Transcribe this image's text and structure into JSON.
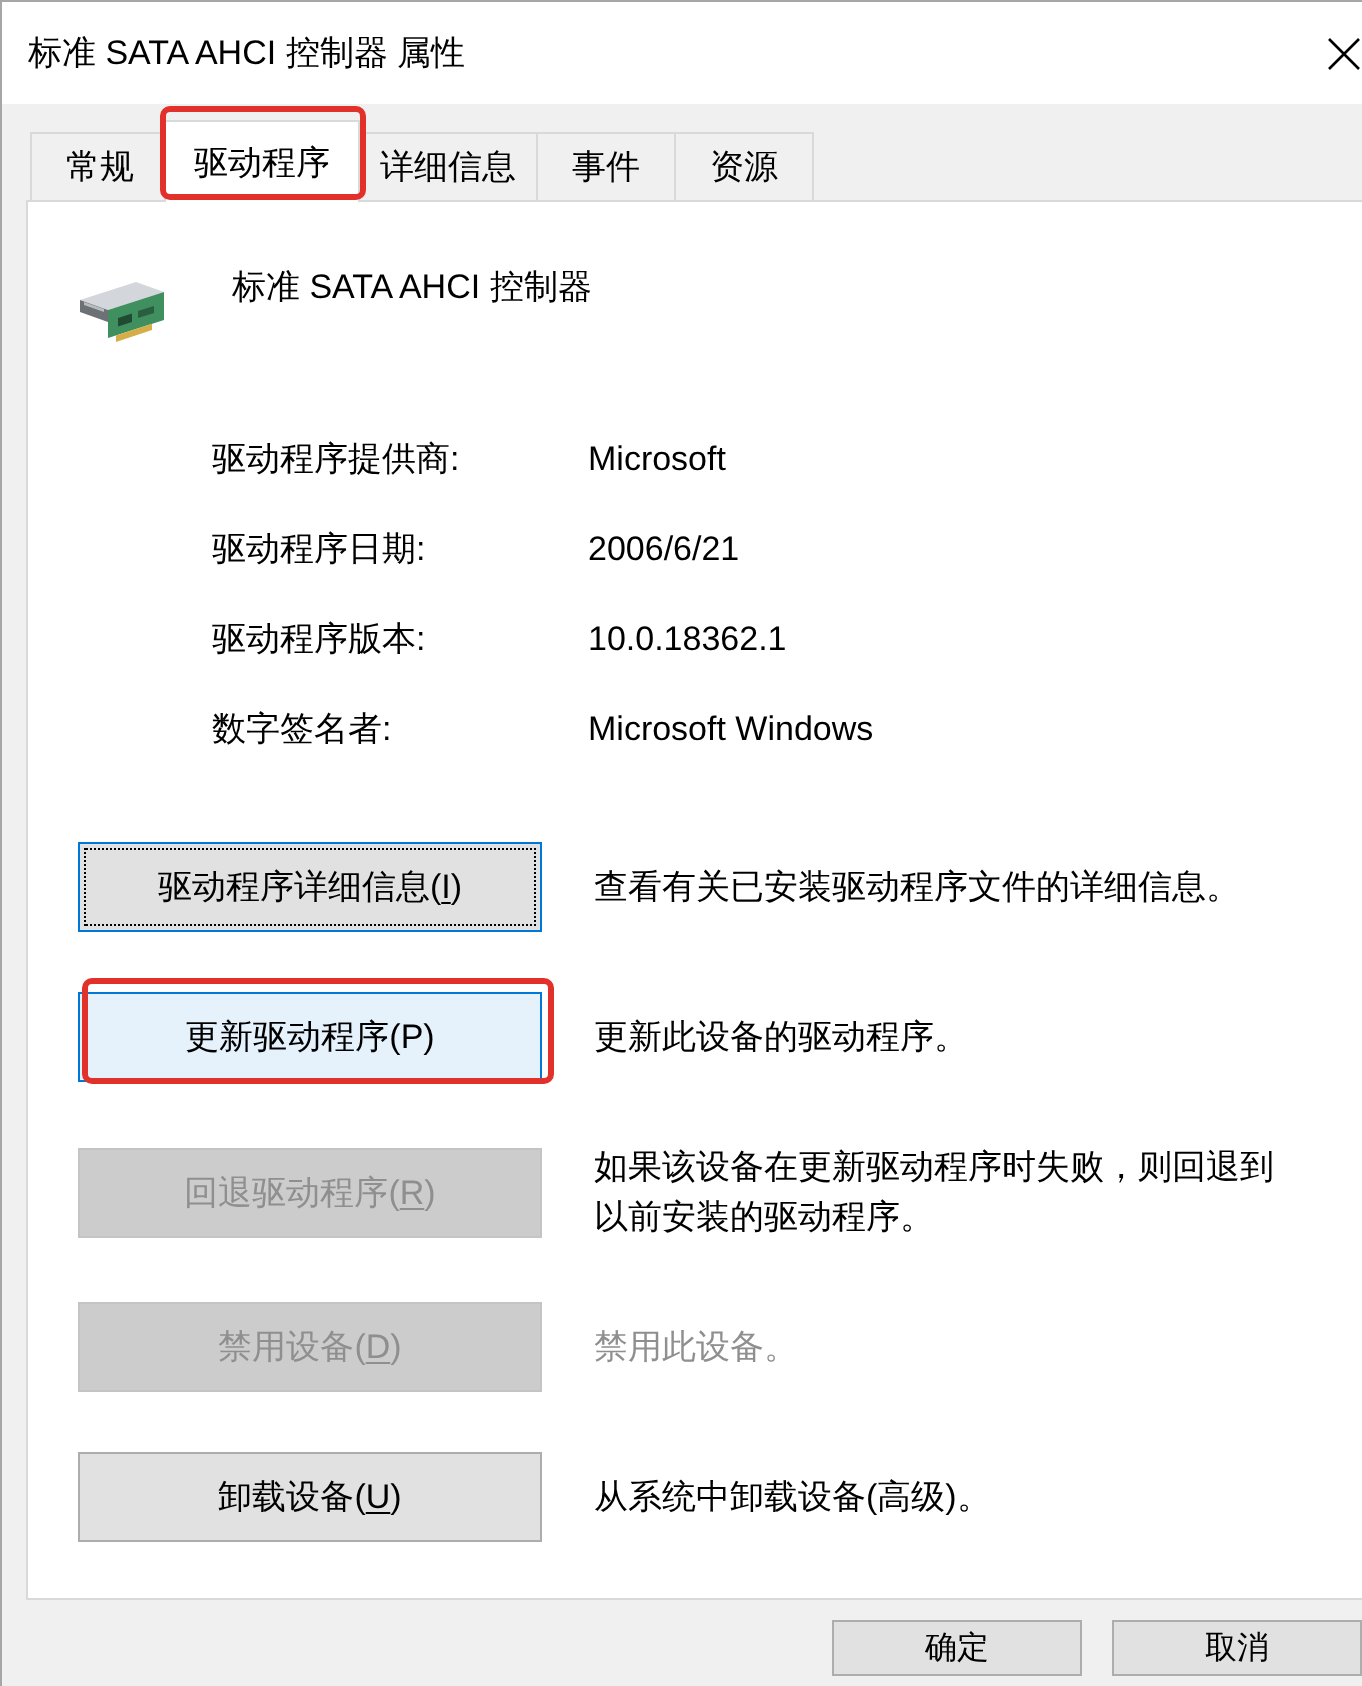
{
  "window": {
    "title": "标准 SATA AHCI 控制器 属性"
  },
  "tabs": [
    {
      "label": "常规",
      "selected": false,
      "highlighted": false
    },
    {
      "label": "驱动程序",
      "selected": true,
      "highlighted": true
    },
    {
      "label": "详细信息",
      "selected": false,
      "highlighted": false
    },
    {
      "label": "事件",
      "selected": false,
      "highlighted": false
    },
    {
      "label": "资源",
      "selected": false,
      "highlighted": false
    }
  ],
  "device": {
    "name": "标准 SATA AHCI 控制器"
  },
  "properties": [
    {
      "label": "驱动程序提供商:",
      "value": "Microsoft"
    },
    {
      "label": "驱动程序日期:",
      "value": "2006/6/21"
    },
    {
      "label": "驱动程序版本:",
      "value": "10.0.18362.1"
    },
    {
      "label": "数字签名者:",
      "value": "Microsoft Windows"
    }
  ],
  "actions": [
    {
      "button": {
        "label": "驱动程序详细信息(I)",
        "access_key_underlined": true,
        "focused": true,
        "hovered": false,
        "disabled": false,
        "highlighted": false
      },
      "description": {
        "text": "查看有关已安装驱动程序文件的详细信息。",
        "disabled": false
      }
    },
    {
      "button": {
        "label": "更新驱动程序(P)",
        "access_key_underlined": false,
        "focused": false,
        "hovered": true,
        "disabled": false,
        "highlighted": true
      },
      "description": {
        "text": "更新此设备的驱动程序。",
        "disabled": false
      }
    },
    {
      "button": {
        "label": "回退驱动程序(R)",
        "access_key_underlined": true,
        "focused": false,
        "hovered": false,
        "disabled": true,
        "highlighted": false
      },
      "description": {
        "text": "如果该设备在更新驱动程序时失败，则回退到以前安装的驱动程序。",
        "disabled": false
      }
    },
    {
      "button": {
        "label": "禁用设备(D)",
        "access_key_underlined": true,
        "focused": false,
        "hovered": false,
        "disabled": true,
        "highlighted": false
      },
      "description": {
        "text": "禁用此设备。",
        "disabled": true
      }
    },
    {
      "button": {
        "label": "卸载设备(U)",
        "access_key_underlined": true,
        "focused": false,
        "hovered": false,
        "disabled": false,
        "highlighted": false
      },
      "description": {
        "text": "从系统中卸载设备(高级)。",
        "disabled": false
      }
    }
  ],
  "dialog_buttons": [
    {
      "label": "确定"
    },
    {
      "label": "取消"
    }
  ]
}
